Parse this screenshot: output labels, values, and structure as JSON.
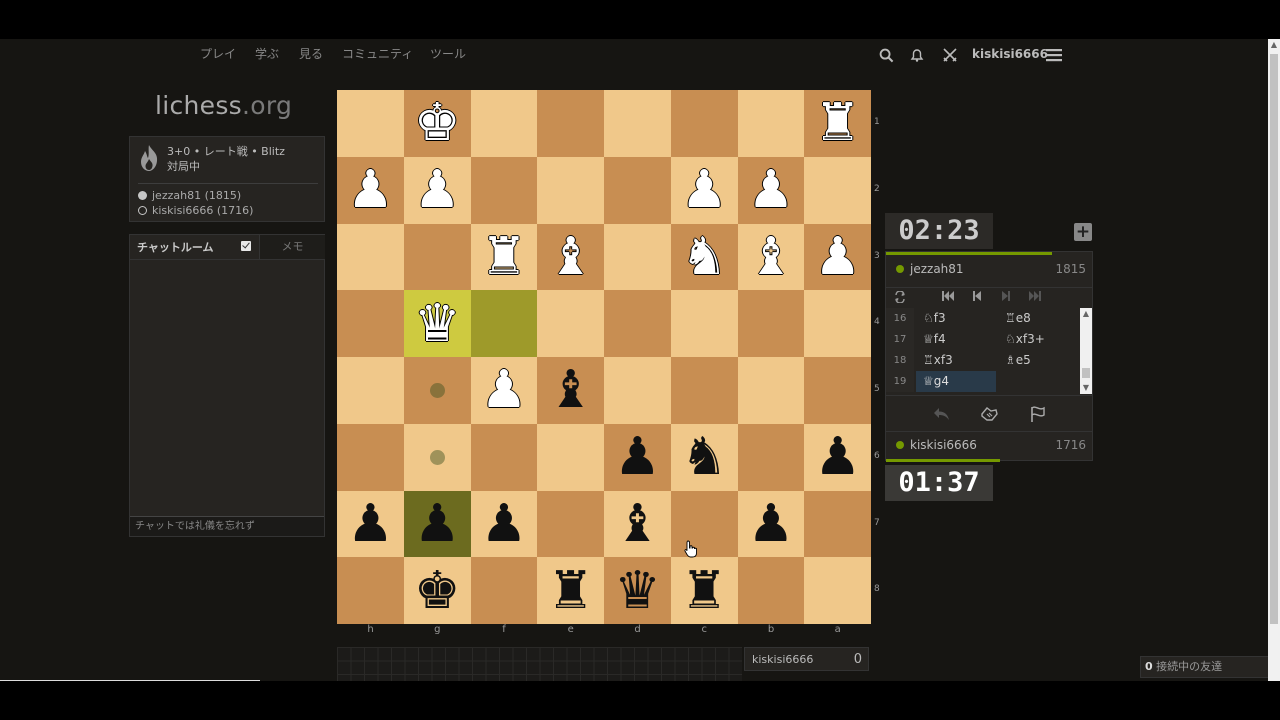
{
  "nav": {
    "links": [
      "プレイ",
      "学ぶ",
      "見る",
      "コミュニティ",
      "ツール"
    ],
    "username": "kiskisi6666"
  },
  "logo": {
    "name": "lichess",
    "tld": ".org"
  },
  "game_info": {
    "title": "3+0 • レート戦 • Blitz",
    "status": "対局中",
    "white_player": "jezzah81 (1815)",
    "black_player": "kiskisi6666 (1716)"
  },
  "chat": {
    "tab_chat": "チャットルーム",
    "tab_notes": "メモ",
    "input_placeholder": "チャットでは礼儀を忘れず"
  },
  "board": {
    "orientation": "black",
    "ranks": [
      "1",
      "2",
      "3",
      "4",
      "5",
      "6",
      "7",
      "8"
    ],
    "files": [
      "h",
      "g",
      "f",
      "e",
      "d",
      "c",
      "b",
      "a"
    ],
    "pieces": [
      {
        "sq": "g1",
        "p": "K",
        "c": "w"
      },
      {
        "sq": "a1",
        "p": "R",
        "c": "w"
      },
      {
        "sq": "h2",
        "p": "P",
        "c": "w"
      },
      {
        "sq": "g2",
        "p": "P",
        "c": "w"
      },
      {
        "sq": "c2",
        "p": "P",
        "c": "w"
      },
      {
        "sq": "b2",
        "p": "P",
        "c": "w"
      },
      {
        "sq": "f3",
        "p": "R",
        "c": "w"
      },
      {
        "sq": "e3",
        "p": "B",
        "c": "w"
      },
      {
        "sq": "c3",
        "p": "N",
        "c": "w"
      },
      {
        "sq": "b3",
        "p": "B",
        "c": "w"
      },
      {
        "sq": "a3",
        "p": "P",
        "c": "w"
      },
      {
        "sq": "g4",
        "p": "Q",
        "c": "w"
      },
      {
        "sq": "f5",
        "p": "P",
        "c": "w"
      },
      {
        "sq": "e5",
        "p": "B",
        "c": "b"
      },
      {
        "sq": "d6",
        "p": "P",
        "c": "b"
      },
      {
        "sq": "c6",
        "p": "N",
        "c": "b"
      },
      {
        "sq": "a6",
        "p": "P",
        "c": "b"
      },
      {
        "sq": "h7",
        "p": "P",
        "c": "b"
      },
      {
        "sq": "g7",
        "p": "P",
        "c": "b"
      },
      {
        "sq": "f7",
        "p": "P",
        "c": "b"
      },
      {
        "sq": "d7",
        "p": "B",
        "c": "b"
      },
      {
        "sq": "b7",
        "p": "P",
        "c": "b"
      },
      {
        "sq": "g8",
        "p": "K",
        "c": "b"
      },
      {
        "sq": "e8",
        "p": "R",
        "c": "b"
      },
      {
        "sq": "d8",
        "p": "Q",
        "c": "b"
      },
      {
        "sq": "c8",
        "p": "R",
        "c": "b"
      }
    ],
    "last_move": [
      "g4",
      "f4"
    ],
    "check_square": "g7",
    "move_dots": [
      "g5",
      "g6"
    ]
  },
  "clocks": {
    "top": "02:23",
    "bottom": "01:37"
  },
  "players": {
    "top": {
      "name": "jezzah81",
      "rating": "1815"
    },
    "bottom": {
      "name": "kiskisi6666",
      "rating": "1716"
    }
  },
  "moves": [
    {
      "n": "16",
      "w": "♘f3",
      "b": "♖e8"
    },
    {
      "n": "17",
      "w": "♕f4",
      "b": "♘xf3+"
    },
    {
      "n": "18",
      "w": "♖xf3",
      "b": "♗e5"
    },
    {
      "n": "19",
      "w": "♕g4",
      "b": ""
    }
  ],
  "score": {
    "name": "kiskisi6666",
    "value": "0"
  },
  "friends": {
    "count": "0",
    "label": " 接続中の友達"
  }
}
